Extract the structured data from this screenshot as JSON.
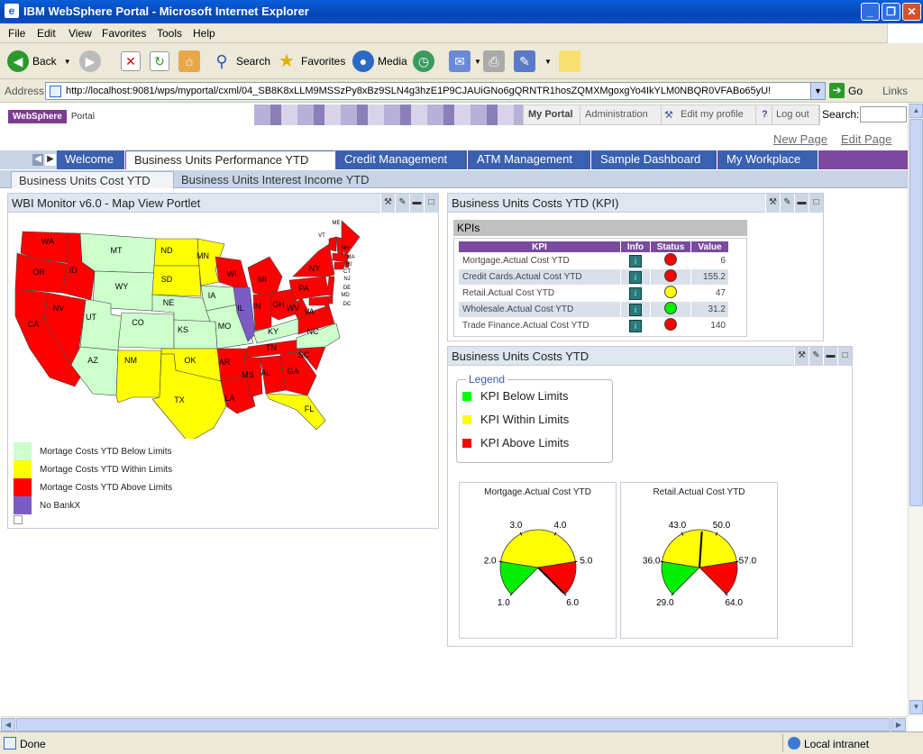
{
  "window": {
    "title": "IBM WebSphere Portal - Microsoft Internet Explorer"
  },
  "menu": [
    "File",
    "Edit",
    "View",
    "Favorites",
    "Tools",
    "Help"
  ],
  "toolbar": {
    "back": "Back",
    "search": "Search",
    "favorites": "Favorites",
    "media": "Media"
  },
  "address": {
    "label": "Address",
    "url": "http://localhost:9081/wps/myportal/cxml/04_SB8K8xLLM9MSSzPy8xBz9SLN4g3hzE1P9CJAUiGNo6gQRNTR1hosZQMXMgoxgYo4IkYLM0NBQR0VFABo65yU!",
    "go": "Go",
    "links": "Links"
  },
  "portal": {
    "logo": "WebSphere",
    "logo_sub": "Portal",
    "nav": {
      "my_portal": "My Portal",
      "admin": "Administration",
      "edit_profile": "Edit my profile",
      "help": "?",
      "logout": "Log out",
      "search": "Search:"
    },
    "new_page": "New Page",
    "edit_page": "Edit Page"
  },
  "tabs": [
    "Welcome",
    "Business Units Performance YTD",
    "Credit Management",
    "ATM Management",
    "Sample Dashboard",
    "My Workplace"
  ],
  "subtabs": [
    "Business Units Cost YTD",
    "Business Units Interest Income YTD"
  ],
  "map_portlet": {
    "title": "WBI Monitor v6.0 - Map View Portlet",
    "legend": [
      {
        "label": "Mortage Costs YTD Below Limits",
        "color": "#ccffcc"
      },
      {
        "label": "Mortage Costs YTD Within Limits",
        "color": "#ffff00"
      },
      {
        "label": "Mortage Costs YTD Above Limits",
        "color": "#ff0000"
      },
      {
        "label": "No BankX",
        "color": "#7b5cc4"
      }
    ],
    "states": [
      {
        "name": "WA",
        "status": "above"
      },
      {
        "name": "OR",
        "status": "above"
      },
      {
        "name": "ID",
        "status": "above"
      },
      {
        "name": "CA",
        "status": "above"
      },
      {
        "name": "NV",
        "status": "above"
      },
      {
        "name": "MT",
        "status": "below"
      },
      {
        "name": "WY",
        "status": "below"
      },
      {
        "name": "UT",
        "status": "below"
      },
      {
        "name": "CO",
        "status": "below"
      },
      {
        "name": "AZ",
        "status": "below"
      },
      {
        "name": "NM",
        "status": "within"
      },
      {
        "name": "ND",
        "status": "within"
      },
      {
        "name": "SD",
        "status": "within"
      },
      {
        "name": "NE",
        "status": "below"
      },
      {
        "name": "KS",
        "status": "below"
      },
      {
        "name": "OK",
        "status": "within"
      },
      {
        "name": "TX",
        "status": "within"
      },
      {
        "name": "MN",
        "status": "within"
      },
      {
        "name": "IA",
        "status": "below"
      },
      {
        "name": "MO",
        "status": "below"
      },
      {
        "name": "AR",
        "status": "above"
      },
      {
        "name": "LA",
        "status": "above"
      },
      {
        "name": "WI",
        "status": "above"
      },
      {
        "name": "IL",
        "status": "none"
      },
      {
        "name": "MI",
        "status": "above"
      },
      {
        "name": "IN",
        "status": "above"
      },
      {
        "name": "OH",
        "status": "above"
      },
      {
        "name": "KY",
        "status": "below"
      },
      {
        "name": "TN",
        "status": "above"
      },
      {
        "name": "MS",
        "status": "above"
      },
      {
        "name": "AL",
        "status": "above"
      },
      {
        "name": "GA",
        "status": "above"
      },
      {
        "name": "FL",
        "status": "within"
      },
      {
        "name": "SC",
        "status": "above"
      },
      {
        "name": "NC",
        "status": "below"
      },
      {
        "name": "VA",
        "status": "above"
      },
      {
        "name": "WV",
        "status": "above"
      },
      {
        "name": "PA",
        "status": "above"
      },
      {
        "name": "NY",
        "status": "above"
      },
      {
        "name": "VT",
        "status": "above"
      },
      {
        "name": "ME",
        "status": "above"
      },
      {
        "name": "NH",
        "status": "above"
      },
      {
        "name": "MA",
        "status": "above"
      },
      {
        "name": "RI",
        "status": "above"
      },
      {
        "name": "CT",
        "status": "above"
      },
      {
        "name": "NJ",
        "status": "above"
      },
      {
        "name": "DE",
        "status": "above"
      },
      {
        "name": "MD",
        "status": "above"
      },
      {
        "name": "DC",
        "status": "above"
      }
    ]
  },
  "kpi_portlet": {
    "title": "Business Units Costs YTD (KPI)",
    "section": "KPIs",
    "columns": [
      "KPI",
      "Info",
      "Status",
      "Value"
    ],
    "rows": [
      {
        "kpi": "Mortgage.Actual Cost YTD",
        "status": "red",
        "value": "6"
      },
      {
        "kpi": "Credit Cards.Actual Cost YTD",
        "status": "red",
        "value": "155.2"
      },
      {
        "kpi": "Retail.Actual Cost YTD",
        "status": "yellow",
        "value": "47"
      },
      {
        "kpi": "Wholesale.Actual Cost YTD",
        "status": "green",
        "value": "31.2"
      },
      {
        "kpi": "Trade Finance.Actual Cost YTD",
        "status": "red",
        "value": "140"
      }
    ]
  },
  "costs_portlet": {
    "title": "Business Units Costs YTD",
    "legend_title": "Legend",
    "legend": [
      {
        "label": "KPI Below Limits",
        "color": "#00ff00"
      },
      {
        "label": "KPI Within Limits",
        "color": "#ffff00"
      },
      {
        "label": "KPI Above Limits",
        "color": "#ff0000"
      }
    ],
    "gauges": [
      {
        "title": "Mortgage.Actual Cost YTD",
        "ticks": [
          "1.0",
          "2.0",
          "3.0",
          "4.0",
          "5.0",
          "6.0"
        ],
        "min": 1.0,
        "max": 6.0,
        "green_to": 2.0,
        "yellow_to": 5.0,
        "value": 6.0
      },
      {
        "title": "Retail.Actual Cost YTD",
        "ticks": [
          "29.0",
          "36.0",
          "43.0",
          "50.0",
          "57.0",
          "64.0"
        ],
        "min": 29.0,
        "max": 64.0,
        "green_to": 36.0,
        "yellow_to": 57.0,
        "value": 47.0
      }
    ]
  },
  "status": {
    "left": "Done",
    "zone": "Local intranet"
  },
  "colors": {
    "below": "#ccffcc",
    "within": "#ffff00",
    "above": "#ff0000",
    "none": "#7b5cc4",
    "tab_blue": "#3a60b0",
    "tab_purple": "#7b4aa0"
  }
}
